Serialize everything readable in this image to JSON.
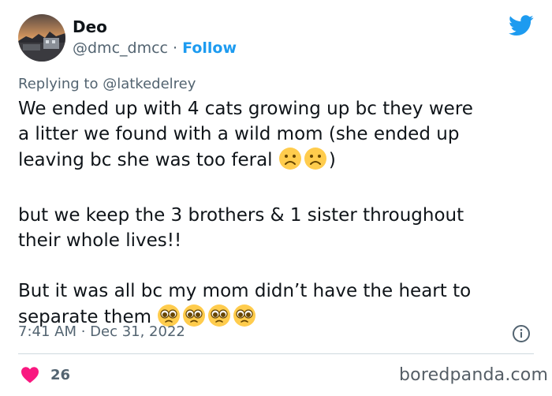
{
  "author": {
    "name": "Deo",
    "handle": "@dmc_dmcc",
    "separator": " · ",
    "follow_label": "Follow"
  },
  "reply": {
    "prefix": "Replying to ",
    "handle": "@latkedelrey"
  },
  "tweet": {
    "paragraph1_line1": "We ended up with 4 cats growing up bc they were",
    "paragraph1_line2": "a litter we found with a wild mom (she ended up",
    "paragraph1_line3": "leaving bc she was too feral",
    "paragraph1_close": ")",
    "paragraph1_emojis": [
      "frowning-face-emoji",
      "frowning-face-emoji"
    ],
    "paragraph2_line1": "but we keep the 3 brothers & 1 sister throughout",
    "paragraph2_line2": "their whole lives!!",
    "paragraph3_line1": "But it was all bc my mom didn’t have the heart to",
    "paragraph3_line2": "separate them ",
    "paragraph3_emojis": [
      "pleading-face-emoji",
      "pleading-face-emoji",
      "pleading-face-emoji",
      "pleading-face-emoji"
    ]
  },
  "timestamp": "7:41 AM · Dec 31, 2022",
  "likes": "26",
  "watermark": "boredpanda.com",
  "colors": {
    "accent": "#1d9bf0",
    "heart": "#f91880",
    "muted": "#536471",
    "text": "#0f1419",
    "emoji": "#ffcc4d"
  },
  "icons": {
    "brand": "twitter-bird-icon",
    "info": "info-icon",
    "like": "heart-icon"
  }
}
